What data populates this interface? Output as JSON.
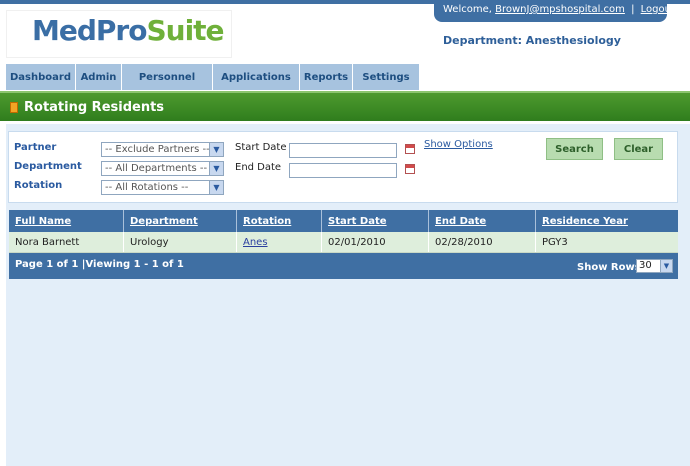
{
  "header": {
    "logo_part1": "MedPro",
    "logo_part2": "Suite",
    "welcome_prefix": "Welcome,",
    "user_email": "BrownJ@mpshospital.com",
    "separator": "|",
    "logout": "Logout",
    "department": "Department: Anesthesiology"
  },
  "nav": {
    "tabs": [
      {
        "label": "Dashboard"
      },
      {
        "label": "Admin"
      },
      {
        "label": "Personnel"
      },
      {
        "label": "Applications"
      },
      {
        "label": "Reports"
      },
      {
        "label": "Settings"
      }
    ]
  },
  "page": {
    "title": "Rotating Residents"
  },
  "filters": {
    "partner_label": "Partner",
    "partner_value": "-- Exclude Partners --",
    "department_label": "Department",
    "department_value": "-- All Departments --",
    "rotation_label": "Rotation",
    "rotation_value": "-- All Rotations --",
    "start_date_label": "Start Date",
    "start_date_value": "",
    "end_date_label": "End Date",
    "end_date_value": "",
    "show_options": "Show Options",
    "search_button": "Search",
    "clear_button": "Clear"
  },
  "table": {
    "columns": [
      "Full Name",
      "Department",
      "Rotation",
      "Start Date",
      "End Date",
      "Residence Year"
    ],
    "rows": [
      [
        "Nora Barnett",
        "Urology",
        "Anes",
        "02/01/2010",
        "02/28/2010",
        "PGY3"
      ]
    ]
  },
  "pager": {
    "info": "Page 1 of 1 |Viewing 1 - 1 of 1",
    "show_rows_label": "Show Rows",
    "rows_value": "30"
  },
  "colors": {
    "header_blue": "#3f6fa3",
    "title_green": "#3a8a26",
    "content_bg": "#e3eef9",
    "row_bg": "#deeedc"
  }
}
